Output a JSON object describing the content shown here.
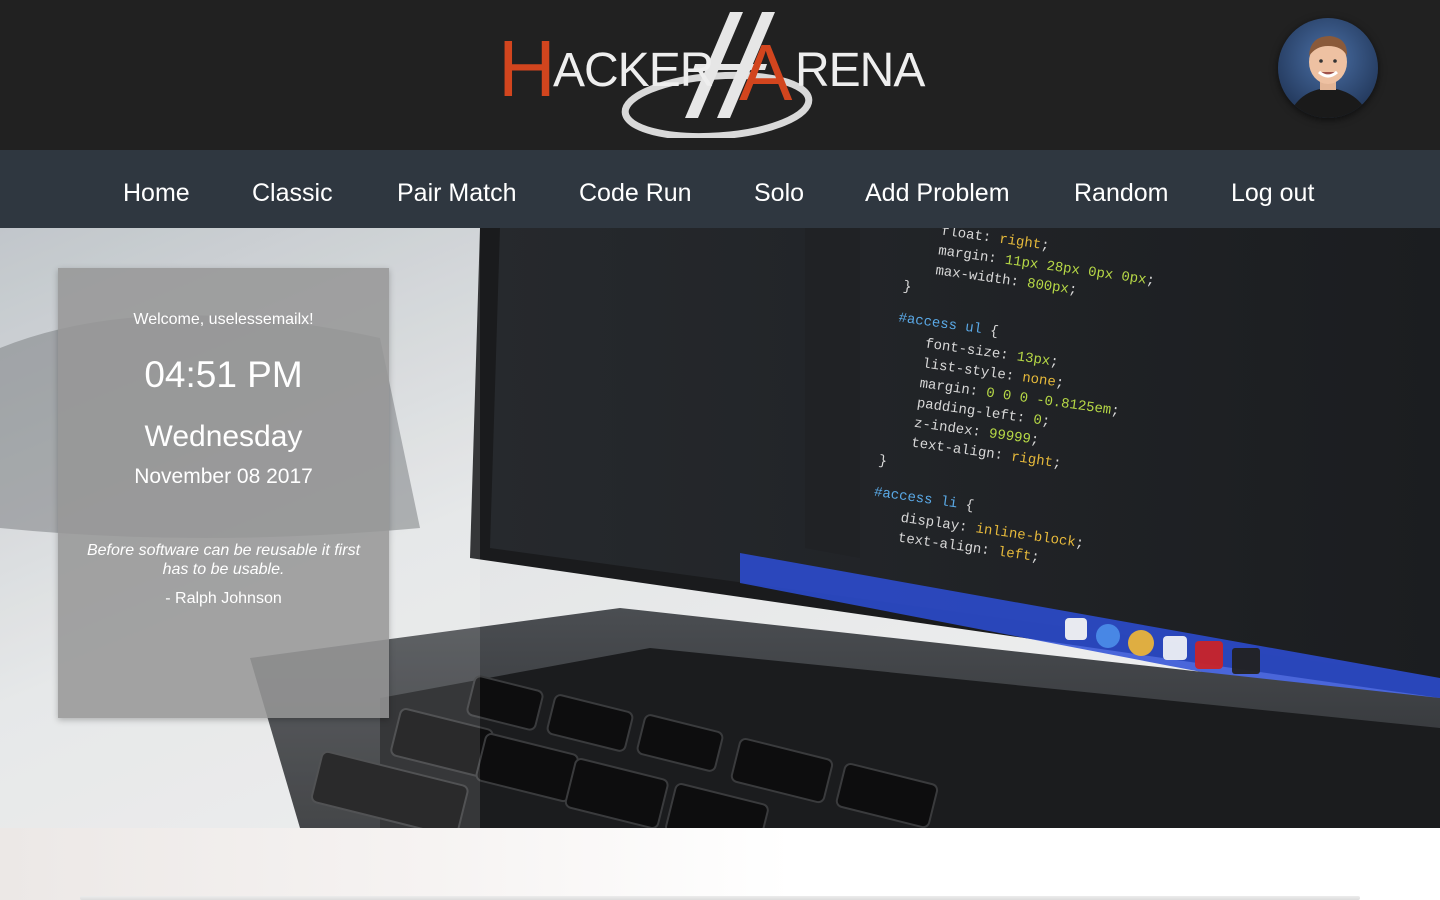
{
  "app": {
    "logo_text": "HACKER ARENA",
    "logo_letter_color": "#d2451e"
  },
  "nav": {
    "items": [
      {
        "label": "Home"
      },
      {
        "label": "Classic"
      },
      {
        "label": "Pair Match"
      },
      {
        "label": "Code Run"
      },
      {
        "label": "Solo"
      },
      {
        "label": "Add Problem"
      },
      {
        "label": "Random"
      },
      {
        "label": "Log out"
      }
    ]
  },
  "dashboard": {
    "welcome": "Welcome, uselessemailx!",
    "time": "04:51 PM",
    "day": "Wednesday",
    "date": "November 08 2017",
    "quote": "Before software can be reusable it first has to be usable.",
    "author": "- Ralph Johnson"
  },
  "colors": {
    "header_bg": "#212121",
    "nav_bg": "#2f3740",
    "card_bg": "#969696"
  }
}
